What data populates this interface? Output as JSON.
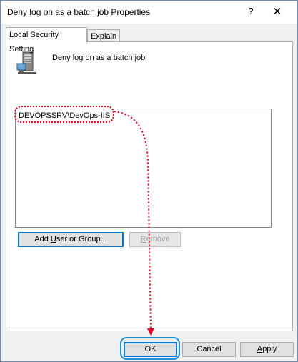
{
  "window": {
    "title": "Deny log on as a batch job Properties",
    "help_glyph": "?",
    "close_glyph": "✕"
  },
  "tabs": [
    {
      "label": "Local Security Setting",
      "active": true
    },
    {
      "label": "Explain",
      "active": false
    }
  ],
  "policy": {
    "name": "Deny log on as a batch job",
    "icon": "server-icon"
  },
  "accounts": [
    "DEVOPSSRV\\DevOps-IIS"
  ],
  "actions": {
    "add_prefix": "Add ",
    "add_u": "U",
    "add_suffix": "ser or Group...",
    "remove_u": "R",
    "remove_suffix": "emove"
  },
  "footer": {
    "ok": "OK",
    "cancel": "Cancel",
    "apply_u": "A",
    "apply_suffix": "pply"
  },
  "annotation_colors": {
    "highlight": "#e0001b",
    "ok_ring": "#1e90d8"
  }
}
